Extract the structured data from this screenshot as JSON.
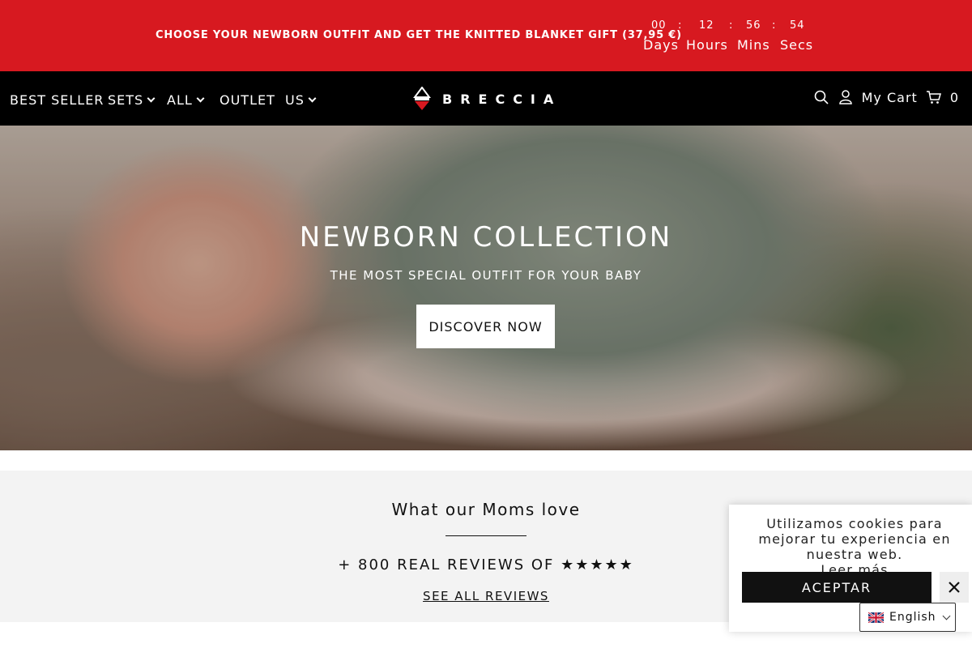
{
  "announcement": {
    "text": "CHOOSE YOUR NEWBORN OUTFIT AND GET THE KNITTED BLANKET GIFT (37,95 €)",
    "countdown": {
      "days": "00",
      "hours": "12",
      "mins": "56",
      "secs": "54",
      "separator": ":",
      "days_label": "Days",
      "hours_label": "Hours",
      "mins_label": "Mins",
      "secs_label": "Secs"
    },
    "background_color": "#d71920"
  },
  "nav": {
    "items": [
      {
        "label": "BEST SELLER"
      },
      {
        "label": "SETS"
      },
      {
        "label": "ALL"
      },
      {
        "label": "OUTLET"
      },
      {
        "label": "US"
      }
    ],
    "logo": "BRECCIA",
    "cart_label": "My Cart",
    "cart_count": "0"
  },
  "hero": {
    "title": "NEWBORN COLLECTION",
    "subtitle": "THE MOST SPECIAL OUTFIT FOR YOUR BABY",
    "button": "DISCOVER NOW"
  },
  "reviews": {
    "title": "What our Moms love",
    "count_text": "+ 800 REAL REVIEWS OF ★★★★★",
    "link": "SEE ALL REVIEWS"
  },
  "cookie": {
    "text": "Utilizamos cookies para mejorar tu experiencia en nuestra web.",
    "link": "Leer más",
    "accept": "ACEPTAR"
  },
  "language": {
    "selected": "English"
  },
  "icons": [
    "search-icon",
    "user-icon",
    "cart-icon",
    "close-icon",
    "chevron-down-icon",
    "uk-flag-icon"
  ]
}
